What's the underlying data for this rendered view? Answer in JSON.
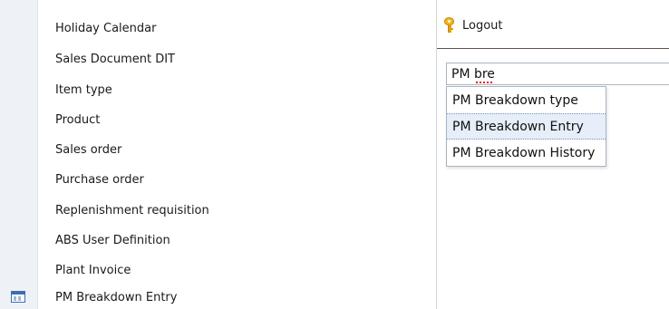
{
  "menu": {
    "items": [
      {
        "label": "Holiday Calendar"
      },
      {
        "label": "Sales Document DIT"
      },
      {
        "label": "Item type"
      },
      {
        "label": "Product"
      },
      {
        "label": "Sales order"
      },
      {
        "label": "Purchase order"
      },
      {
        "label": "Replenishment requisition"
      },
      {
        "label": "ABS User Definition"
      },
      {
        "label": "Plant Invoice"
      },
      {
        "label": "PM Breakdown Entry",
        "icon": "table-icon"
      }
    ]
  },
  "header": {
    "logout_label": "Logout",
    "logout_icon": "key-icon"
  },
  "search": {
    "value": "PM bre",
    "suggestions": [
      {
        "label": "PM Breakdown type"
      },
      {
        "label": "PM Breakdown Entry",
        "active": true
      },
      {
        "label": "PM Breakdown History"
      }
    ]
  },
  "colors": {
    "gutter": "#eef1f5",
    "highlight": "#e6eef9",
    "icon_blue": "#3b6fb0",
    "key_gold": "#f2b51c"
  }
}
